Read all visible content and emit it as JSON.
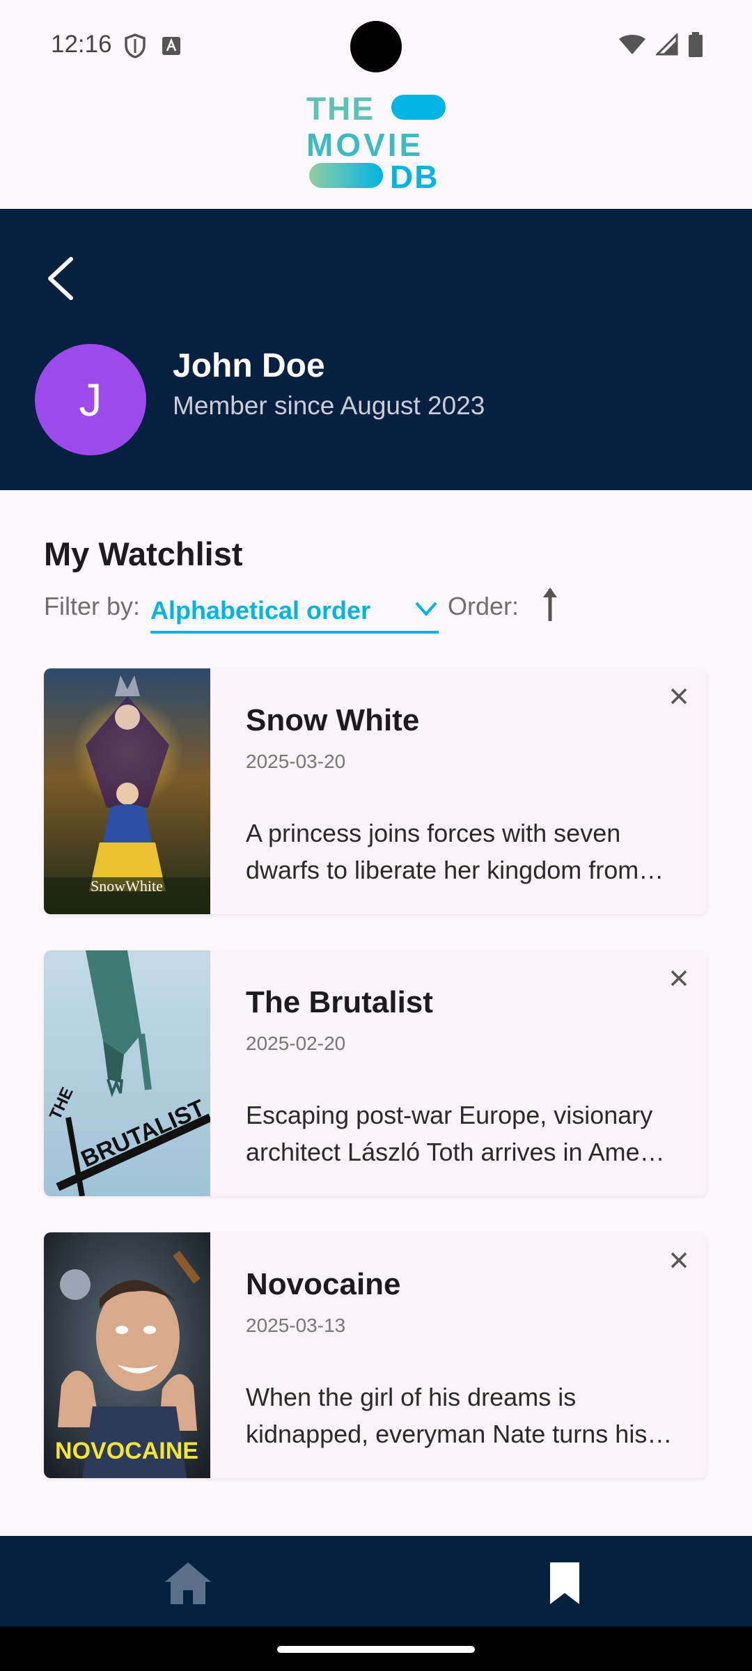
{
  "status_bar": {
    "time": "12:16",
    "icons": [
      "shield-icon",
      "keyboard-a-icon",
      "wifi-icon",
      "signal-icon",
      "battery-icon"
    ]
  },
  "app": {
    "logo_lines": [
      "THE",
      "MOVIE",
      "DB"
    ]
  },
  "profile": {
    "avatar_initial": "J",
    "name": "John Doe",
    "member_since": "Member since August 2023"
  },
  "watchlist": {
    "title": "My Watchlist",
    "filter_label": "Filter by:",
    "filter_value": "Alphabetical order",
    "order_label": "Order:",
    "order_direction": "ascending",
    "movies": [
      {
        "title": "Snow White",
        "date": "2025-03-20",
        "overview_line1": "A princess joins forces with seven",
        "overview_line2": "dwarfs to liberate her kingdom from…",
        "poster_text": "SnowWhite"
      },
      {
        "title": "The Brutalist",
        "date": "2025-02-20",
        "overview_line1": "Escaping post-war Europe, visionary",
        "overview_line2": "architect László Toth arrives in Ame…",
        "poster_text_top": "THE",
        "poster_text_main": "BRUTALIST"
      },
      {
        "title": "Novocaine",
        "date": "2025-03-13",
        "overview_line1": "When the girl of his dreams is",
        "overview_line2": "kidnapped, everyman Nate turns his…",
        "poster_text": "NOVOCAINE"
      }
    ]
  },
  "bottom_nav": {
    "items": [
      "home-icon",
      "bookmark-icon"
    ]
  },
  "colors": {
    "header_bg": "#062140",
    "accent": "#01B4E4",
    "avatar": "#9C4AEB",
    "logo_green": "#90CEA1"
  }
}
